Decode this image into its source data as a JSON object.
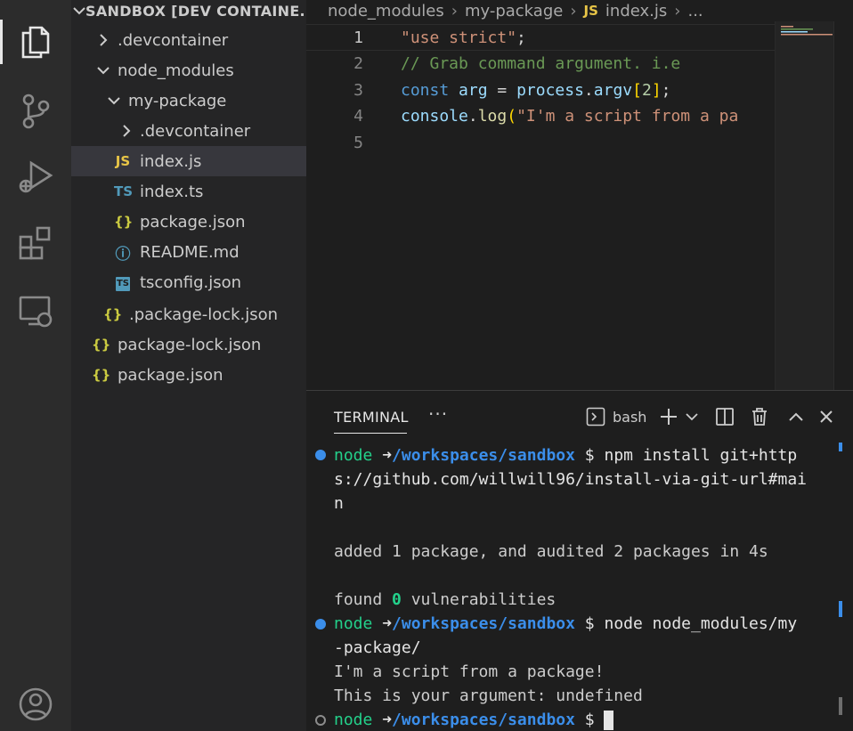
{
  "explorer": {
    "title": "SANDBOX [DEV CONTAINE...",
    "items": [
      {
        "label": ".devcontainer",
        "type": "folder-collapsed"
      },
      {
        "label": "node_modules",
        "type": "folder-expanded"
      },
      {
        "label": "my-package",
        "type": "folder-expanded"
      },
      {
        "label": ".devcontainer",
        "type": "folder-collapsed"
      },
      {
        "label": "index.js",
        "type": "js",
        "icon_text": "JS"
      },
      {
        "label": "index.ts",
        "type": "ts",
        "icon_text": "TS"
      },
      {
        "label": "package.json",
        "type": "json",
        "icon_text": "{}"
      },
      {
        "label": "README.md",
        "type": "info",
        "icon_text": "ⓘ"
      },
      {
        "label": "tsconfig.json",
        "type": "tsconfig",
        "icon_text": "TS"
      },
      {
        "label": ".package-lock.json",
        "type": "json",
        "icon_text": "{}"
      },
      {
        "label": "package-lock.json",
        "type": "json",
        "icon_text": "{}"
      },
      {
        "label": "package.json",
        "type": "json",
        "icon_text": "{}"
      }
    ]
  },
  "breadcrumb": {
    "part1": "node_modules",
    "part2": "my-package",
    "file_icon": "JS",
    "part3": "index.js",
    "part4": "..."
  },
  "editor": {
    "line_numbers": [
      "1",
      "2",
      "3",
      "4",
      "5"
    ],
    "line1": {
      "str": "\"use strict\"",
      "semi": ";"
    },
    "line2": {
      "comment": "// Grab command argument. i.e"
    },
    "line3": {
      "kw": "const",
      "var": "arg",
      "eq": " = ",
      "obj": "process",
      "dot": ".",
      "prop": "argv",
      "lb": "[",
      "num": "2",
      "rb": "]",
      "semi": ";"
    },
    "line4": {
      "obj": "console",
      "dot": ".",
      "fn": "log",
      "lp": "(",
      "str": "\"I'm a script from a pa"
    }
  },
  "panel": {
    "tab_label": "TERMINAL",
    "more": "···",
    "shell_label": "bash",
    "icons": [
      "terminal-icon",
      "plus-icon",
      "chevron-down-icon",
      "split-icon",
      "trash-icon",
      "chevron-up-icon",
      "close-icon"
    ]
  },
  "terminal": {
    "prompt_user": "node",
    "prompt_arrow": "➜",
    "prompt_path": "/workspaces/sandbox",
    "prompt_dollar": "$",
    "cmd1_part1": " npm install git+http",
    "cmd1_part2": "s://github.com/willwill96/install-via-git-url#mai",
    "cmd1_part3": "n",
    "out1": "added 1 package, and audited 2 packages in 4s",
    "out2_pre": "found ",
    "out2_num": "0",
    "out2_post": " vulnerabilities",
    "cmd2_part1": " node node_modules/my",
    "cmd2_part2": "-package/",
    "out3": "I'm a script from a package!",
    "out4": "This is your argument: undefined"
  },
  "colors": {
    "accent_blue": "#3b8eea",
    "prompt_green": "#23d18b",
    "js_yellow": "#e8c547",
    "ts_blue": "#519aba"
  }
}
